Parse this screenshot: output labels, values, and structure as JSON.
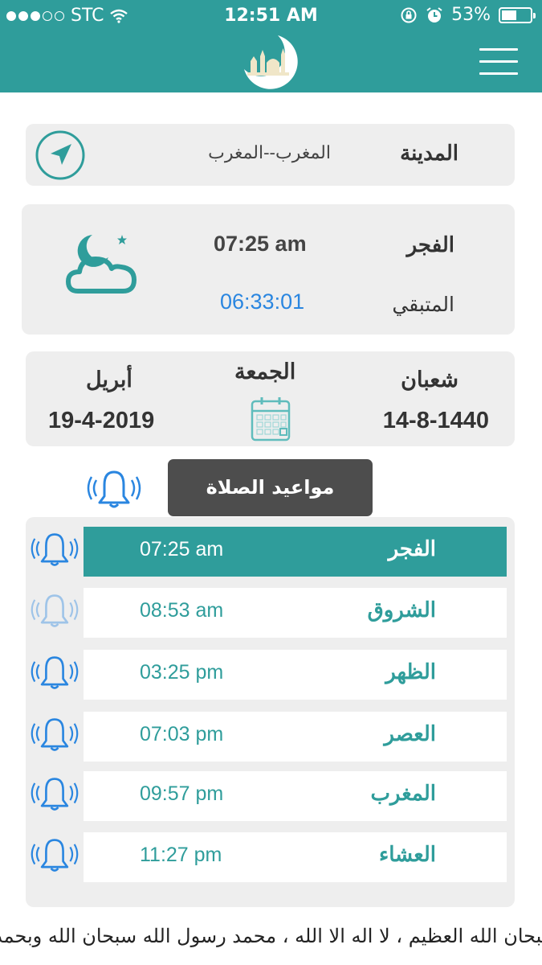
{
  "status_bar": {
    "carrier": "STC",
    "time": "12:51 AM",
    "battery": "53%",
    "battery_level": 0.53,
    "signal_bars": 3
  },
  "header": {
    "logo_icon": "crescent-mosque-logo",
    "menu_icon": "hamburger-menu-icon"
  },
  "city": {
    "label": "المدينة",
    "value": "المغرب--المغرب"
  },
  "next_prayer": {
    "name": "الفجر",
    "time": "07:25 am",
    "remaining_label": "المتبقي",
    "countdown": "06:33:01",
    "icon": "night-cloud-icon"
  },
  "date": {
    "hijri_month": "شعبان",
    "hijri_date": "14-8-1440",
    "weekday": "الجمعة",
    "gregorian_month": "أبريل",
    "gregorian_date": "19-4-2019"
  },
  "prayers_title": "مواعيد الصلاة",
  "prayers": [
    {
      "name": "الفجر",
      "time": "07:25 am",
      "active": true,
      "alert_on": true
    },
    {
      "name": "الشروق",
      "time": "08:53 am",
      "active": false,
      "alert_on": false
    },
    {
      "name": "الظهر",
      "time": "03:25 pm",
      "active": false,
      "alert_on": true
    },
    {
      "name": "العصر",
      "time": "07:03 pm",
      "active": false,
      "alert_on": true
    },
    {
      "name": "المغرب",
      "time": "09:57 pm",
      "active": false,
      "alert_on": true
    },
    {
      "name": "العشاء",
      "time": "11:27 pm",
      "active": false,
      "alert_on": true
    }
  ],
  "ticker": "سبحان الله العظيم ، لا اله الا الله ، محمد رسول الله      سبحان الله وبحمده سبحان ا",
  "colors": {
    "primary": "#2f9d9b",
    "bell": "#2a86e0",
    "title_tab": "#4d4d4d"
  }
}
